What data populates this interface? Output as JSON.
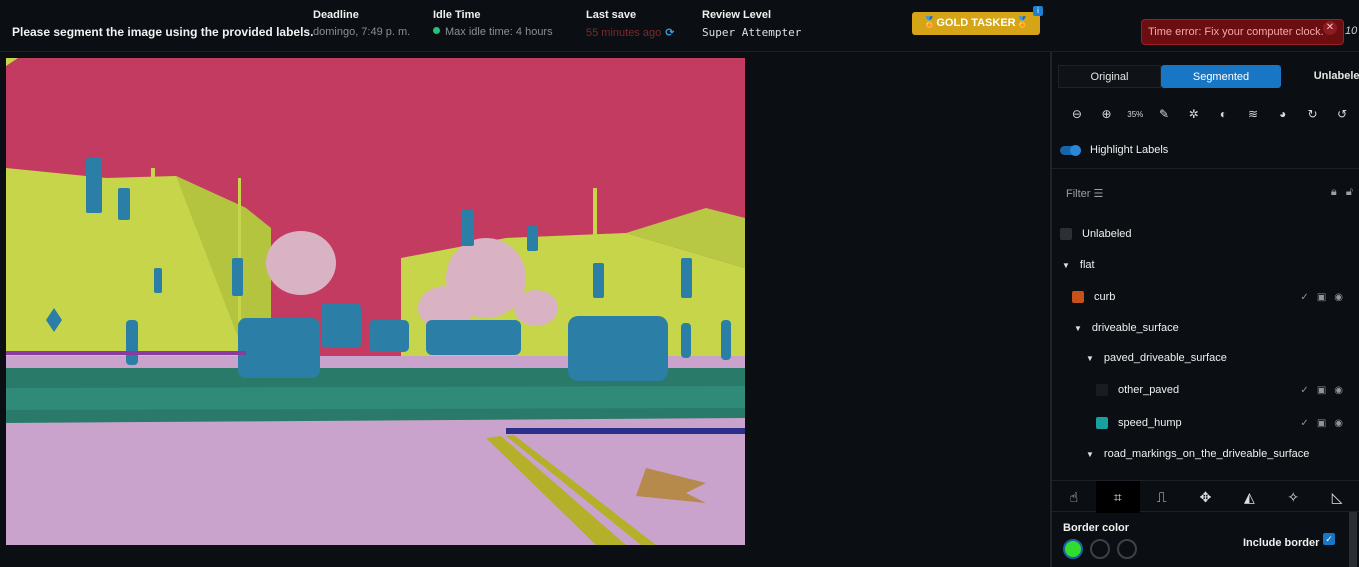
{
  "header": {
    "instruction": "Please segment the image using the provided labels.",
    "deadline_label": "Deadline",
    "deadline_value": "domingo, 7:49 p. m.",
    "idle_label": "Idle Time",
    "idle_value": "Max idle time: 4 hours",
    "lastsave_label": "Last save",
    "lastsave_value": "55 minutes ago",
    "review_label": "Review Level",
    "review_value": "Super Attempter",
    "gold_label": "🏅GOLD TASKER🏅",
    "gold_badge": "i",
    "error_text": "Time error: Fix your computer clock.",
    "error_tail": "10"
  },
  "view_tabs": {
    "original": "Original",
    "segmented": "Segmented",
    "unlabeled": "Unlabeled"
  },
  "zoom": "35%",
  "highlight_label": "Highlight Labels",
  "filter_label": "Filter",
  "tree": {
    "unlabeled": "Unlabeled",
    "flat": "flat",
    "curb": "curb",
    "driveable_surface": "driveable_surface",
    "paved_driveable_surface": "paved_driveable_surface",
    "other_paved": "other_paved",
    "speed_hump": "speed_hump",
    "road_markings": "road_markings_on_the_driveable_surface"
  },
  "colors": {
    "curb": "#c8501a",
    "other_paved": "#1a1d20",
    "speed_hump": "#18a0a0",
    "unlabeled": "#2c3035",
    "sky": "#c43b61",
    "building": "#c6d54a",
    "road": "#c9a3cc",
    "vehicle": "#2b7ea6",
    "crosswalk": "#2a7a6a",
    "tree": "#d9b3c4"
  },
  "border_color_label": "Border color",
  "include_border_label": "Include border"
}
